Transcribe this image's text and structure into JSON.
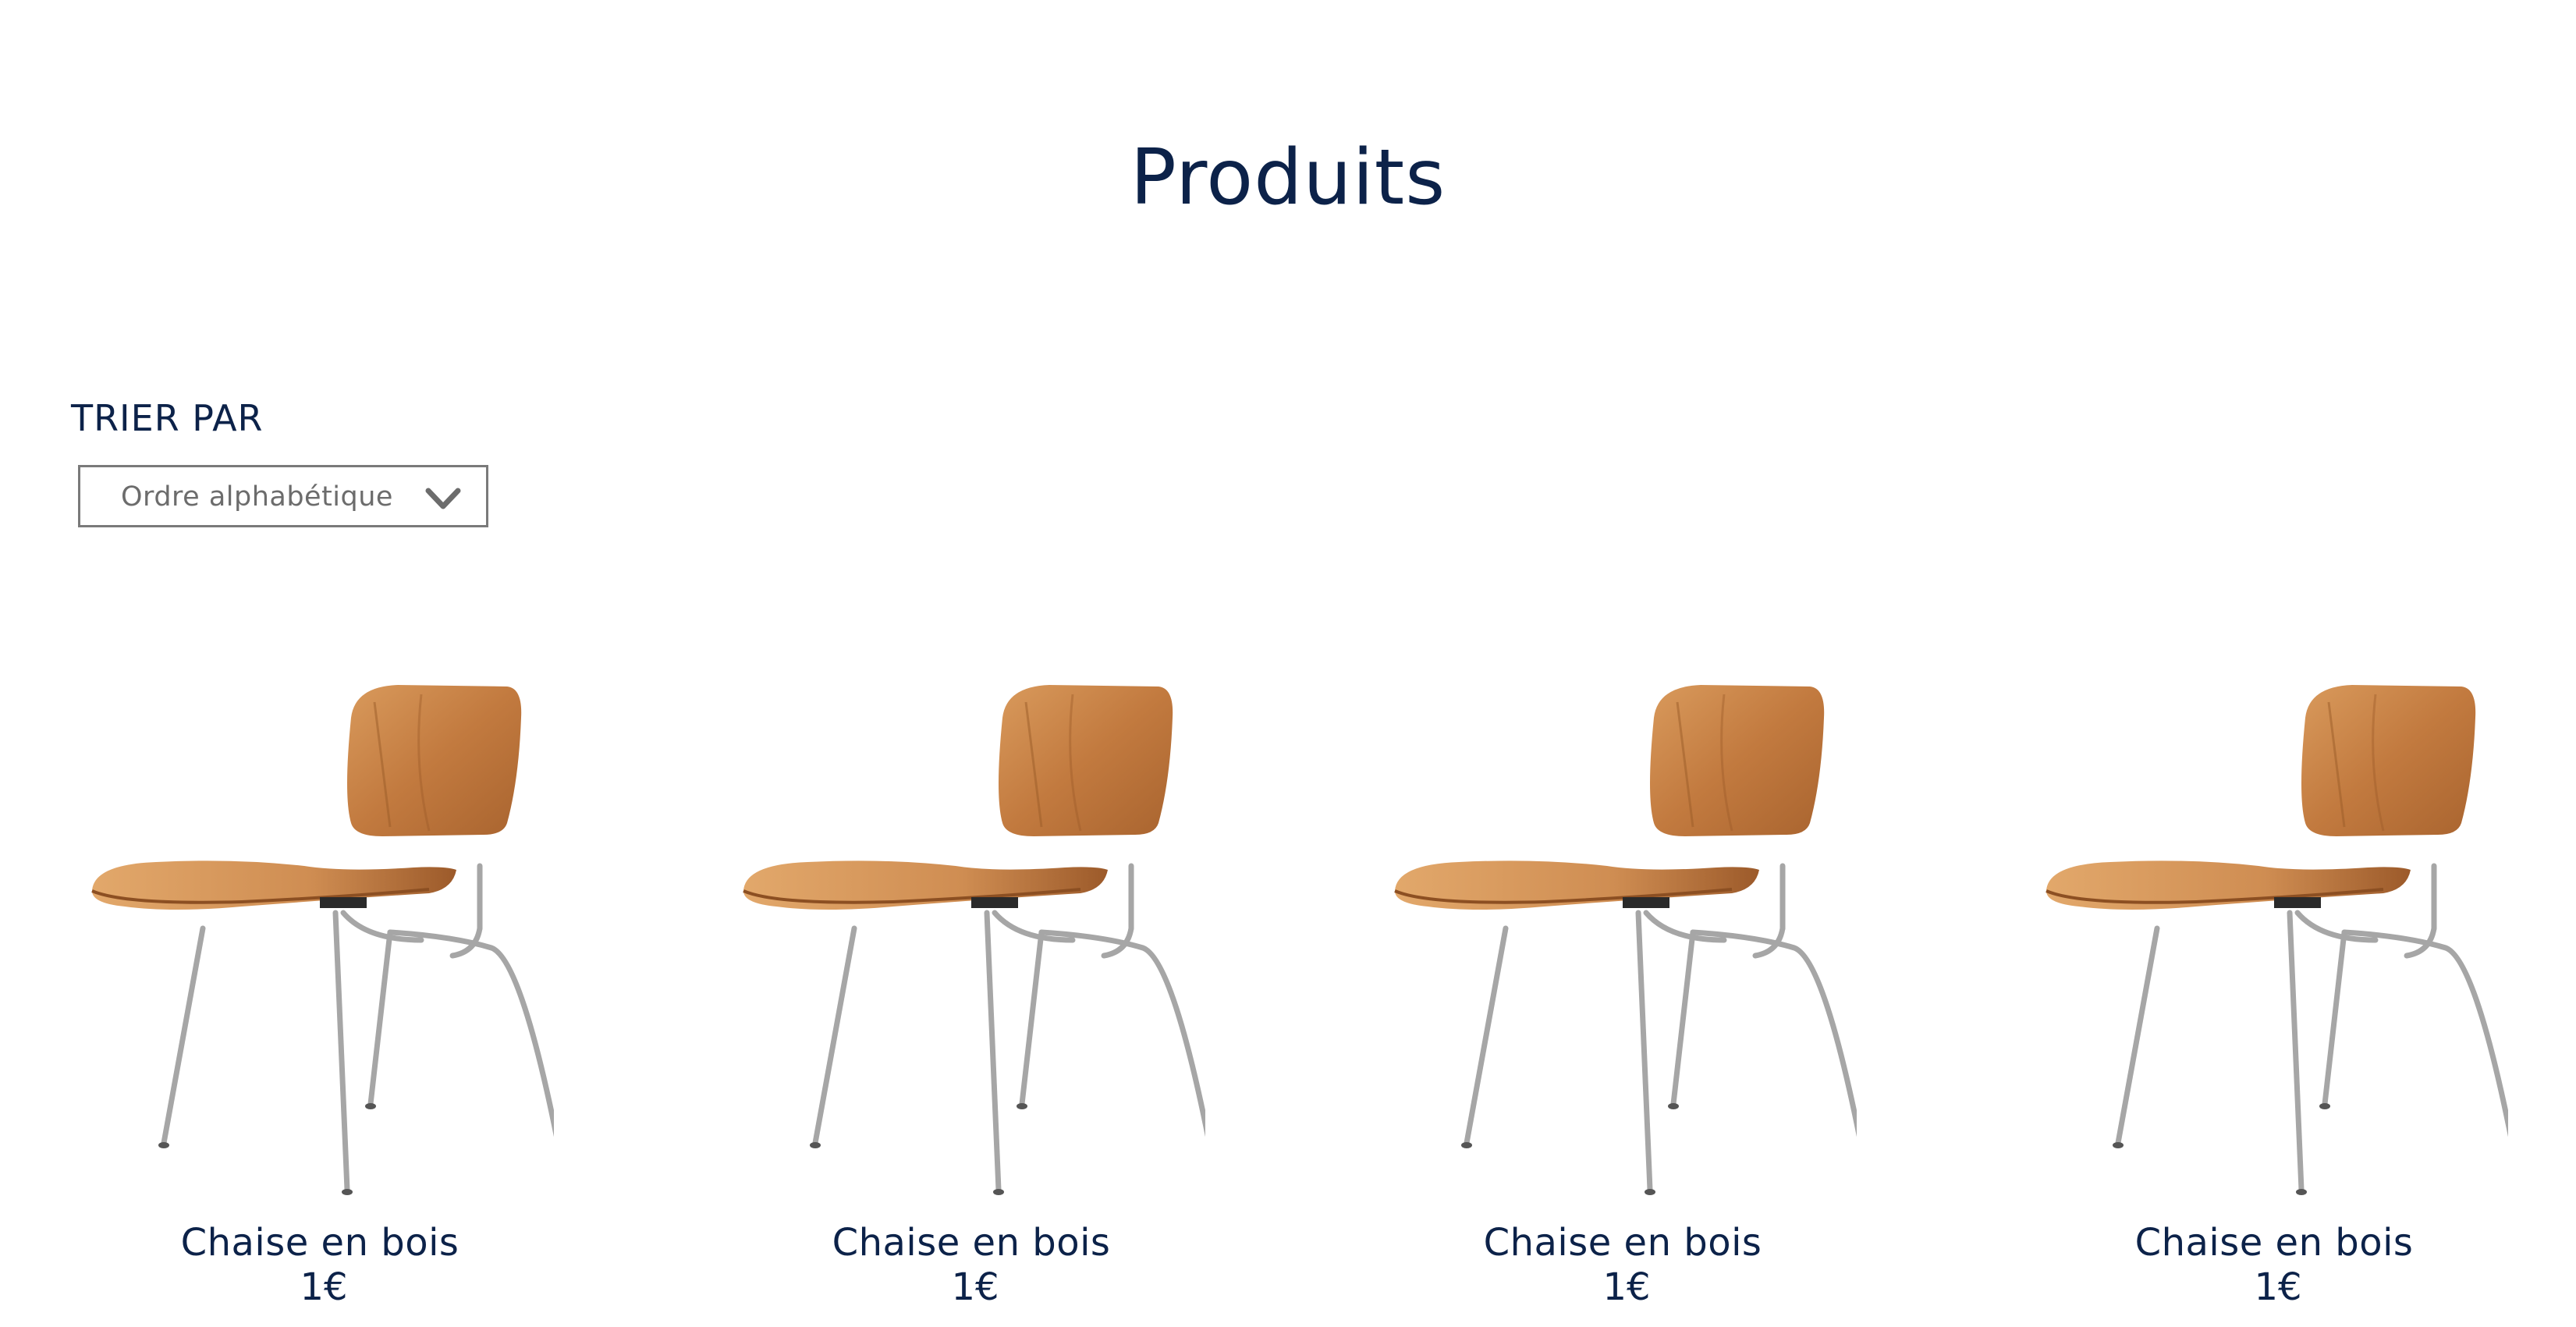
{
  "page": {
    "title": "Produits"
  },
  "sort": {
    "label": "TRIER PAR",
    "selected": "Ordre alphabétique",
    "icon": "chevron-down-icon"
  },
  "products": [
    {
      "name": "Chaise en bois",
      "price": "1€",
      "image": "wooden-chair-image"
    },
    {
      "name": "Chaise en bois",
      "price": "1€",
      "image": "wooden-chair-image"
    },
    {
      "name": "Chaise en bois",
      "price": "1€",
      "image": "wooden-chair-image"
    },
    {
      "name": "Chaise en bois",
      "price": "1€",
      "image": "wooden-chair-image"
    }
  ],
  "colors": {
    "text": "#0c2249",
    "select_border": "#7a7a7a",
    "select_text": "#6c6c6c",
    "wood": "#c8884e",
    "steel": "#a9a9a9"
  }
}
